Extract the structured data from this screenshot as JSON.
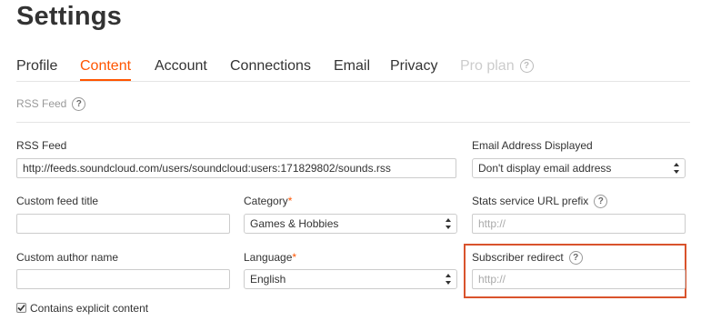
{
  "page": {
    "title": "Settings"
  },
  "tabs": [
    {
      "label": "Profile",
      "state": "normal"
    },
    {
      "label": "Content",
      "state": "active"
    },
    {
      "label": "Account",
      "state": "normal"
    },
    {
      "label": "Connections",
      "state": "normal"
    },
    {
      "label": "Email",
      "state": "normal"
    },
    {
      "label": "Privacy",
      "state": "normal"
    },
    {
      "label": "Pro plan",
      "state": "disabled"
    }
  ],
  "help_glyph": "?",
  "section": {
    "title": "RSS Feed"
  },
  "form": {
    "rss_feed": {
      "label": "RSS Feed",
      "value": "http://feeds.soundcloud.com/users/soundcloud:users:171829802/sounds.rss"
    },
    "email_displayed": {
      "label": "Email Address Displayed",
      "value": "Don't display email address"
    },
    "custom_feed_title": {
      "label": "Custom feed title",
      "value": ""
    },
    "category": {
      "label": "Category",
      "required_mark": "*",
      "value": "Games & Hobbies"
    },
    "stats_prefix": {
      "label": "Stats service URL prefix",
      "placeholder": "http://"
    },
    "custom_author": {
      "label": "Custom author name",
      "value": ""
    },
    "language": {
      "label": "Language",
      "required_mark": "*",
      "value": "English"
    },
    "subscriber_redirect": {
      "label": "Subscriber redirect",
      "placeholder": "http://"
    },
    "explicit": {
      "label": "Contains explicit content",
      "checked": true
    }
  },
  "colors": {
    "accent": "#ff5500",
    "highlight_border": "#d9532c"
  }
}
